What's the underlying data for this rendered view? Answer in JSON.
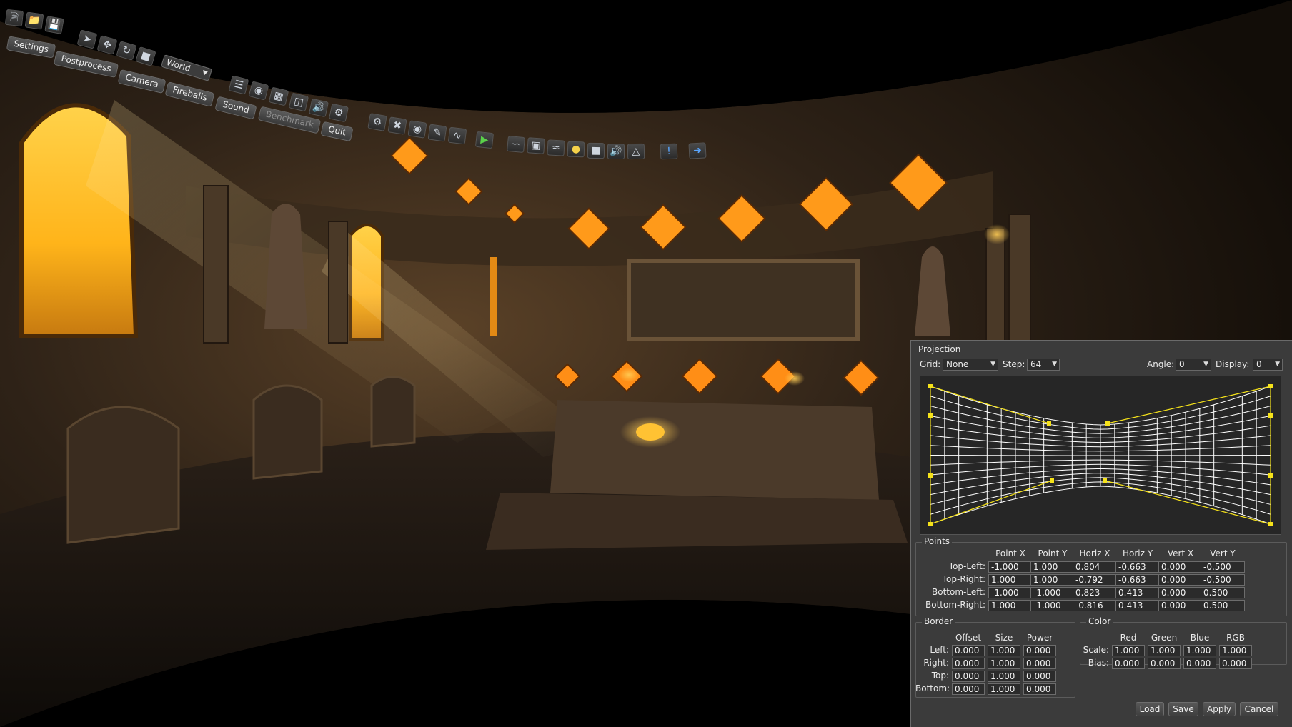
{
  "toolbar": {
    "top_icons": [
      "new-file-icon",
      "open-folder-icon",
      "save-icon"
    ],
    "tools": [
      "select-arrow-icon",
      "move-icon",
      "rotate-icon",
      "scale-icon"
    ],
    "space_select": "World",
    "tabs": [
      {
        "label": "Settings",
        "enabled": true
      },
      {
        "label": "Postprocess",
        "enabled": true
      },
      {
        "label": "Camera",
        "enabled": true
      },
      {
        "label": "Fireballs",
        "enabled": true
      },
      {
        "label": "Sound",
        "enabled": true
      },
      {
        "label": "Benchmark",
        "enabled": false
      },
      {
        "label": "Quit",
        "enabled": true
      }
    ]
  },
  "projection": {
    "title": "Projection",
    "grid_label": "Grid:",
    "grid_value": "None",
    "step_label": "Step:",
    "step_value": "64",
    "angle_label": "Angle:",
    "angle_value": "0",
    "display_label": "Display:",
    "display_value": "0",
    "points": {
      "title": "Points",
      "columns": [
        "Point X",
        "Point Y",
        "Horiz X",
        "Horiz Y",
        "Vert X",
        "Vert Y"
      ],
      "rows": [
        {
          "label": "Top-Left:",
          "values": [
            "-1.000",
            "1.000",
            "0.804",
            "-0.663",
            "0.000",
            "-0.500"
          ]
        },
        {
          "label": "Top-Right:",
          "values": [
            "1.000",
            "1.000",
            "-0.792",
            "-0.663",
            "0.000",
            "-0.500"
          ]
        },
        {
          "label": "Bottom-Left:",
          "values": [
            "-1.000",
            "-1.000",
            "0.823",
            "0.413",
            "0.000",
            "0.500"
          ]
        },
        {
          "label": "Bottom-Right:",
          "values": [
            "1.000",
            "-1.000",
            "-0.816",
            "0.413",
            "0.000",
            "0.500"
          ]
        }
      ]
    },
    "border": {
      "title": "Border",
      "columns": [
        "Offset",
        "Size",
        "Power"
      ],
      "rows": [
        {
          "label": "Left:",
          "values": [
            "0.000",
            "1.000",
            "0.000"
          ]
        },
        {
          "label": "Right:",
          "values": [
            "0.000",
            "1.000",
            "0.000"
          ]
        },
        {
          "label": "Top:",
          "values": [
            "0.000",
            "1.000",
            "0.000"
          ]
        },
        {
          "label": "Bottom:",
          "values": [
            "0.000",
            "1.000",
            "0.000"
          ]
        }
      ]
    },
    "color": {
      "title": "Color",
      "columns": [
        "Red",
        "Green",
        "Blue",
        "RGB"
      ],
      "rows": [
        {
          "label": "Scale:",
          "values": [
            "1.000",
            "1.000",
            "1.000",
            "1.000"
          ]
        },
        {
          "label": "Bias:",
          "values": [
            "0.000",
            "0.000",
            "0.000",
            "0.000"
          ]
        }
      ]
    },
    "buttons": {
      "load": "Load",
      "save": "Save",
      "apply": "Apply",
      "cancel": "Cancel"
    }
  },
  "colors": {
    "grid_line": "#ffffff",
    "control_point": "#f5e21a",
    "accent_glow": "#ffb21e"
  }
}
